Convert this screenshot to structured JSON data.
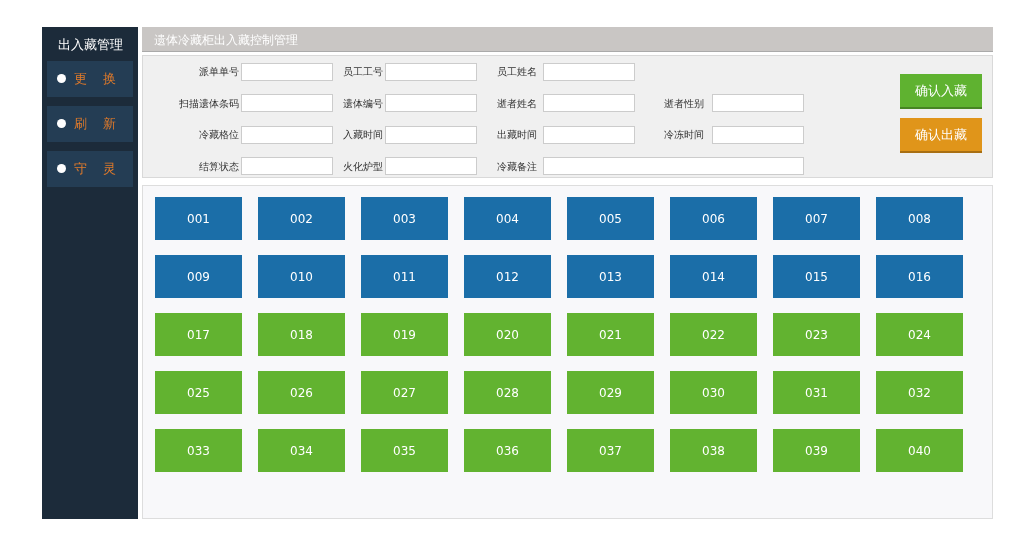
{
  "sidebar": {
    "title": "出入藏管理",
    "items": [
      {
        "label": "更 换"
      },
      {
        "label": "刷 新"
      },
      {
        "label": "守 灵"
      }
    ]
  },
  "header": {
    "title": "遗体冷藏柜出入藏控制管理"
  },
  "form": {
    "rows": [
      [
        {
          "label": "派单单号"
        },
        {
          "label": "员工工号"
        },
        {
          "label": "员工姓名"
        }
      ],
      [
        {
          "label": "扫描遗体条码"
        },
        {
          "label": "遗体编号"
        },
        {
          "label": "逝者姓名"
        },
        {
          "label": "逝者性别"
        }
      ],
      [
        {
          "label": "冷藏格位"
        },
        {
          "label": "入藏时间"
        },
        {
          "label": "出藏时间"
        },
        {
          "label": "冷冻时间"
        }
      ],
      [
        {
          "label": "结算状态"
        },
        {
          "label": "火化炉型"
        },
        {
          "label": "冷藏备注",
          "wide": true
        }
      ]
    ]
  },
  "buttons": [
    {
      "label": "确认入藏",
      "kind": "confirm-in"
    },
    {
      "label": "确认出藏",
      "kind": "confirm-out"
    }
  ],
  "compartments": [
    {
      "label": "001",
      "color": "#1b6ea8"
    },
    {
      "label": "002",
      "color": "#1b6ea8"
    },
    {
      "label": "003",
      "color": "#1b6ea8"
    },
    {
      "label": "004",
      "color": "#1b6ea8"
    },
    {
      "label": "005",
      "color": "#1b6ea8"
    },
    {
      "label": "006",
      "color": "#1b6ea8"
    },
    {
      "label": "007",
      "color": "#1b6ea8"
    },
    {
      "label": "008",
      "color": "#1b6ea8"
    },
    {
      "label": "009",
      "color": "#1b6ea8"
    },
    {
      "label": "010",
      "color": "#1b6ea8"
    },
    {
      "label": "011",
      "color": "#1b6ea8"
    },
    {
      "label": "012",
      "color": "#1b6ea8"
    },
    {
      "label": "013",
      "color": "#1b6ea8"
    },
    {
      "label": "014",
      "color": "#1b6ea8"
    },
    {
      "label": "015",
      "color": "#1b6ea8"
    },
    {
      "label": "016",
      "color": "#1b6ea8"
    },
    {
      "label": "017",
      "color": "#62b330"
    },
    {
      "label": "018",
      "color": "#62b330"
    },
    {
      "label": "019",
      "color": "#62b330"
    },
    {
      "label": "020",
      "color": "#62b330"
    },
    {
      "label": "021",
      "color": "#62b330"
    },
    {
      "label": "022",
      "color": "#62b330"
    },
    {
      "label": "023",
      "color": "#62b330"
    },
    {
      "label": "024",
      "color": "#62b330"
    },
    {
      "label": "025",
      "color": "#62b330"
    },
    {
      "label": "026",
      "color": "#62b330"
    },
    {
      "label": "027",
      "color": "#62b330"
    },
    {
      "label": "028",
      "color": "#62b330"
    },
    {
      "label": "029",
      "color": "#62b330"
    },
    {
      "label": "030",
      "color": "#62b330"
    },
    {
      "label": "031",
      "color": "#62b330"
    },
    {
      "label": "032",
      "color": "#62b330"
    },
    {
      "label": "033",
      "color": "#62b330"
    },
    {
      "label": "034",
      "color": "#62b330"
    },
    {
      "label": "035",
      "color": "#62b330"
    },
    {
      "label": "036",
      "color": "#62b330"
    },
    {
      "label": "037",
      "color": "#62b330"
    },
    {
      "label": "038",
      "color": "#62b330"
    },
    {
      "label": "039",
      "color": "#62b330"
    },
    {
      "label": "040",
      "color": "#62b330"
    }
  ]
}
